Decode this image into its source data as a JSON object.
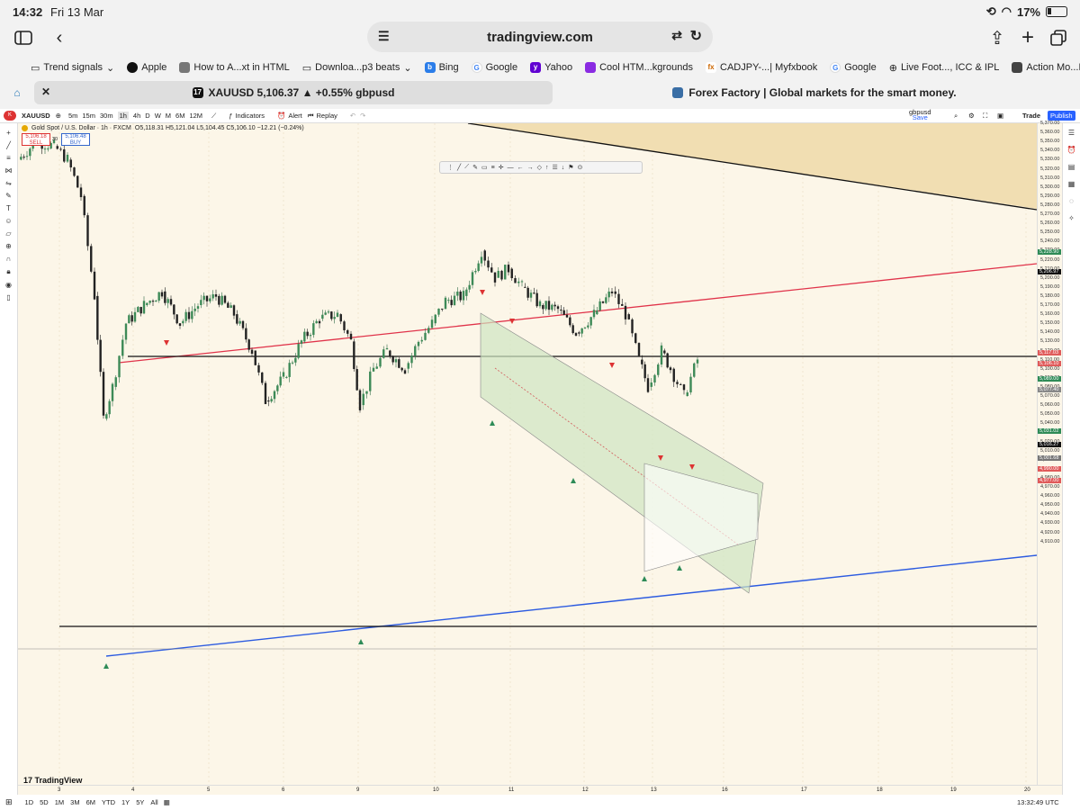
{
  "status": {
    "time": "14:32",
    "date": "Fri 13 Mar",
    "battery": "17%"
  },
  "browser": {
    "url": "tradingview.com"
  },
  "bookmarks": [
    "Trend signals",
    "Apple",
    "How to A...xt in HTML",
    "Downloa...p3 beats",
    "Bing",
    "Google",
    "Yahoo",
    "Cool HTM...kgrounds",
    "CADJPY-...| Myfxbook",
    "Google",
    "Live Foot..., ICC & IPL",
    "Action Mo...NaijaPrey"
  ],
  "tabs": {
    "active": "XAUUSD 5,106.37 ▲ +0.55% gbpusd",
    "other": "Forex Factory | Global markets for the smart money."
  },
  "tv": {
    "symbol": "XAUUSD",
    "intervals": [
      "5m",
      "15m",
      "30m",
      "1h",
      "4h",
      "D",
      "W",
      "M",
      "6M",
      "12M"
    ],
    "indicators": "Indicators",
    "alert": "Alert",
    "replay": "Replay",
    "layout": "gbpusd",
    "save": "Save",
    "trade": "Trade",
    "publish": "Publish",
    "legend_title": "Gold Spot / U.S. Dollar · 1h · FXCM",
    "legend_ohlc": "O5,118.31 H5,121.04 L5,104.45 C5,106.10 −12.21 (−0.24%)",
    "sell_price": "5,106.18",
    "sell": "SELL",
    "spread": "30",
    "buy_price": "5,106.48",
    "buy": "BUY",
    "watermark": "TradingView",
    "ranges": [
      "1D",
      "5D",
      "1M",
      "3M",
      "6M",
      "YTD",
      "1Y",
      "5Y",
      "All"
    ],
    "clock": "13:32:49 UTC",
    "date_labels": [
      "3",
      "4",
      "5",
      "6",
      "9",
      "10",
      "11",
      "12",
      "13",
      "16",
      "17",
      "18",
      "19",
      "20"
    ],
    "price_ticks": [
      "5,370.00",
      "5,360.00",
      "5,350.00",
      "5,340.00",
      "5,330.00",
      "5,320.00",
      "5,310.00",
      "5,300.00",
      "5,290.00",
      "5,280.00",
      "5,270.00",
      "5,260.00",
      "5,250.00",
      "5,240.00",
      "5,230.00",
      "5,220.00",
      "5,210.00",
      "5,200.00",
      "5,190.00",
      "5,180.00",
      "5,170.00",
      "5,160.00",
      "5,150.00",
      "5,140.00",
      "5,130.00",
      "5,120.00",
      "5,110.00",
      "5,100.00",
      "5,090.00",
      "5,080.00",
      "5,070.00",
      "5,060.00",
      "5,050.00",
      "5,040.00",
      "5,030.00",
      "5,020.00",
      "5,010.00",
      "5,000.00",
      "4,990.00",
      "4,980.00",
      "4,970.00",
      "4,960.00",
      "4,950.00",
      "4,940.00",
      "4,930.00",
      "4,920.00",
      "4,910.00"
    ],
    "price_flags": [
      {
        "label": "5,228.90",
        "color": "#2e8b57",
        "price": 5228.9
      },
      {
        "label": "5,206.97",
        "color": "#111111",
        "price": 5206.97
      },
      {
        "label": "5,117.03",
        "color": "#e05a5a",
        "price": 5117.03
      },
      {
        "label": "5,106.10",
        "color": "#e05a5a",
        "price": 5106.1
      },
      {
        "label": "5,089.00",
        "color": "#2e8b57",
        "price": 5089
      },
      {
        "label": "5,077.40",
        "color": "#888888",
        "price": 5077.4
      },
      {
        "label": "5,031.02",
        "color": "#2e8b57",
        "price": 5031.02
      },
      {
        "label": "5,016.27",
        "color": "#111111",
        "price": 5016.27
      },
      {
        "label": "5,001.68",
        "color": "#777777",
        "price": 5001.68
      },
      {
        "label": "4,990.00",
        "color": "#e05a5a",
        "price": 4990
      },
      {
        "label": "4,977.00",
        "color": "#e05a5a",
        "price": 4977
      }
    ]
  }
}
